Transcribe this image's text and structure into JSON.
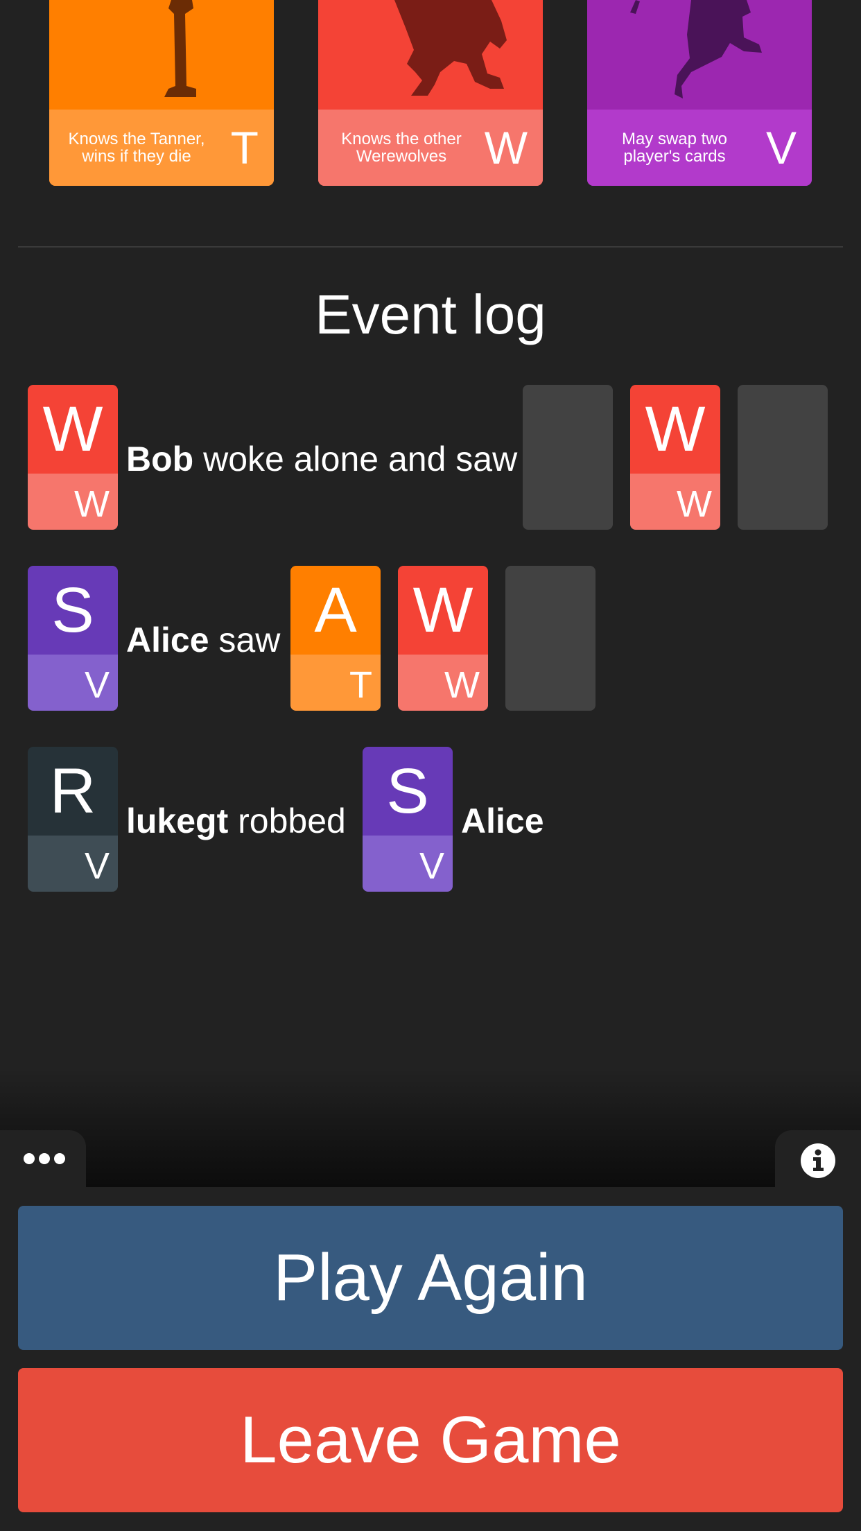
{
  "colors": {
    "background": "#222222",
    "werewolf": "#f44336",
    "minion": "#ff7f00",
    "villager_purple": "#673ab7",
    "troublemaker": "#b23acb",
    "robber": "#263238",
    "hidden": "#424242",
    "play_again": "#375a7f",
    "leave_game": "#e74c3c"
  },
  "role_cards": [
    {
      "description": "Knows the Tanner, wins if they die",
      "letter": "T"
    },
    {
      "description": "Knows the other Werewolves",
      "letter": "W"
    },
    {
      "description": "May swap two player's cards",
      "letter": "V"
    }
  ],
  "event_log": {
    "title": "Event log",
    "entries": [
      {
        "actor_card": {
          "role": "W",
          "team": "W"
        },
        "actor": "Bob",
        "action": "woke alone and saw",
        "seen_cards": [
          {
            "hidden": true
          },
          {
            "role": "W",
            "team": "W"
          },
          {
            "hidden": true
          }
        ]
      },
      {
        "actor_card": {
          "role": "S",
          "team": "V"
        },
        "actor": "Alice",
        "action": "saw",
        "seen_cards": [
          {
            "role": "A",
            "team": "T"
          },
          {
            "role": "W",
            "team": "W"
          },
          {
            "hidden": true
          }
        ]
      },
      {
        "actor_card": {
          "role": "R",
          "team": "V"
        },
        "actor": "lukegt",
        "action": "robbed",
        "target_card": {
          "role": "S",
          "team": "V"
        },
        "target": "Alice"
      }
    ]
  },
  "bottom_bar": {
    "menu_icon": "more-dots-icon",
    "info_icon": "info-circle-icon"
  },
  "buttons": {
    "play_again": "Play Again",
    "leave_game": "Leave Game"
  }
}
